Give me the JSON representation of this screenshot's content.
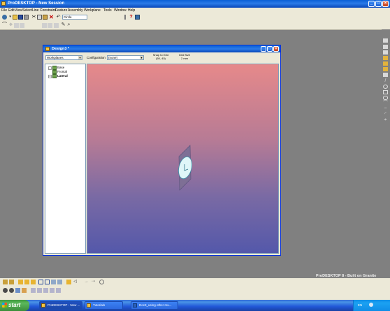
{
  "app": {
    "title": "ProDESKTOP - New Session",
    "window_controls": [
      "_",
      "□",
      "×"
    ]
  },
  "menu": [
    "File",
    "Edit",
    "View",
    "Select",
    "Line",
    "Constraint",
    "Feature",
    "Assembly",
    "Workplane",
    "Tools",
    "Window",
    "Help"
  ],
  "toolbar": {
    "line_style_value": "Circle"
  },
  "design_window": {
    "title": "Design3 *",
    "workplanes_select": "Workplanes",
    "configuration_label": "Configuration",
    "configuration_value": "(none)",
    "snap_to_grid_label": "Snap to Grid",
    "snap_to_grid_value": "(50, 40)",
    "grid_size_label": "Grid Size",
    "grid_size_value": "2 mm",
    "window_controls": [
      "_",
      "□",
      "×"
    ],
    "tree": [
      {
        "label": "Base"
      },
      {
        "label": "Frontal"
      },
      {
        "label": "Lateral"
      }
    ]
  },
  "watermark": "ProDESKTOP 8 - Built on Granite",
  "taskbar": {
    "start_label": "start",
    "tasks": [
      "ProDESKTOP - New ...",
      "Tutorials",
      "Doc3_using other mu..."
    ],
    "language": "EN",
    "clock": ""
  },
  "colors": {
    "desktop_bg": "#808080",
    "titlebar": "#0a5fd6",
    "viewport_top": "#e6898a",
    "viewport_bottom": "#5458aa",
    "taskbar": "#2b63d3",
    "start": "#3c9a3c"
  }
}
